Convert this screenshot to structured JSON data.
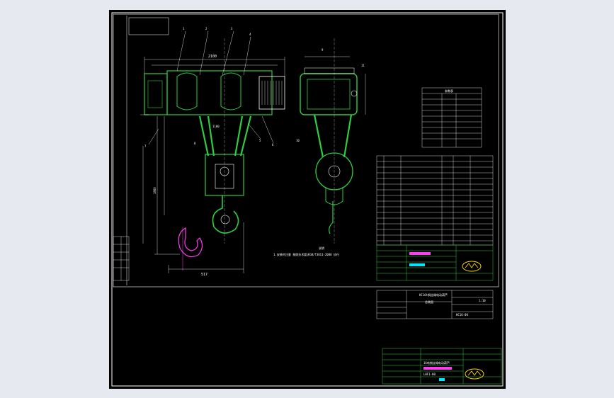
{
  "drawing": {
    "dimensions": {
      "width_top": "2100",
      "width_sub": "1180",
      "height_left": "1860",
      "hook_offset": "517"
    },
    "part_numbers": [
      "1",
      "2",
      "3",
      "4",
      "5",
      "6",
      "7",
      "8",
      "9",
      "10",
      "11"
    ],
    "note_title": "说明",
    "note_text": "1.安装时注意 按照技术要求GB/T3811-2008 执行",
    "title_block": {
      "drawing_name": "HC16t钢丝绳电动葫芦",
      "sheet_name": "总装图",
      "drawing_code": "HC16-00",
      "scale": "1:10"
    },
    "bottom_block": {
      "drawing_code": "LHF1-00",
      "label": "16吨钢丝绳电动葫芦"
    },
    "param_table_title": "参数表"
  },
  "colors": {
    "background": "#000000",
    "outline": "#ffffff",
    "machine_green": "#2ecc40",
    "accent_magenta": "#ff3cf0",
    "accent_cyan": "#00e5ff",
    "logo_yellow": "#ffd400",
    "page_bg": "#e6e9ef"
  }
}
